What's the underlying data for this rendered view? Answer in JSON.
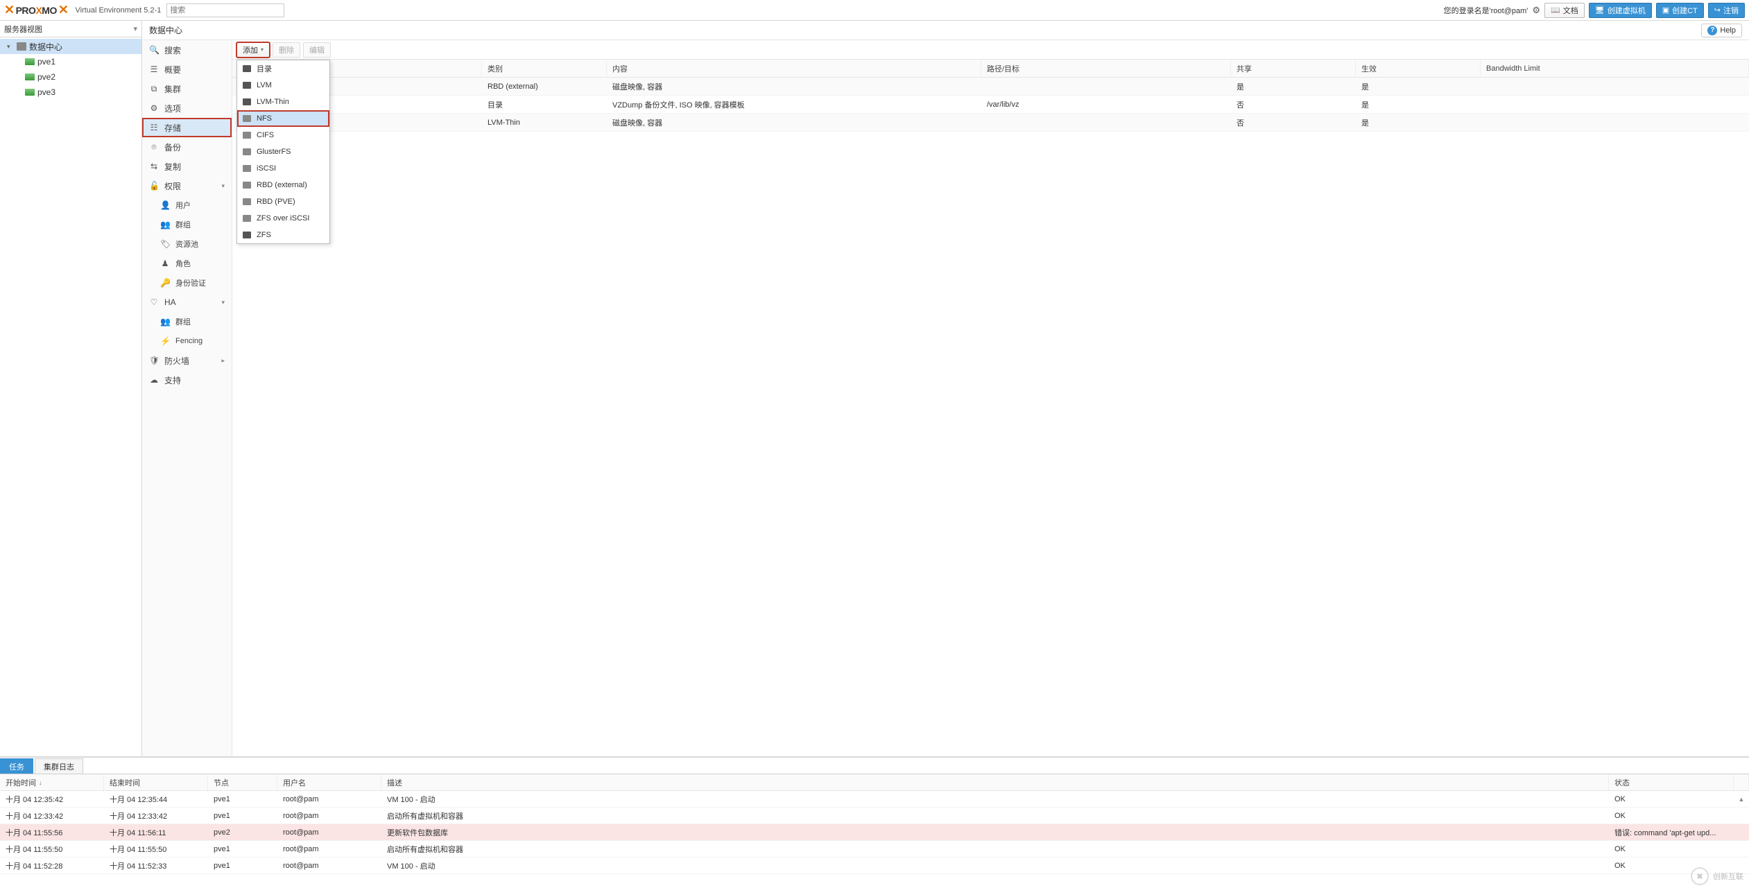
{
  "header": {
    "product": {
      "pro": "PRO",
      "x": "X",
      "mo": "MO"
    },
    "version_label": "Virtual Environment 5.2-1",
    "search_placeholder": "搜索",
    "login_text": "您的登录名是'root@pam'",
    "docs_label": "文档",
    "create_vm_label": "创建虚拟机",
    "create_ct_label": "创建CT",
    "logout_label": "注销"
  },
  "tree": {
    "view_label": "服务器视图",
    "datacenter_label": "数据中心",
    "nodes": [
      "pve1",
      "pve2",
      "pve3"
    ]
  },
  "crumb": {
    "title": "数据中心",
    "help": "Help"
  },
  "subnav": {
    "search": "搜索",
    "summary": "概要",
    "cluster": "集群",
    "options": "选项",
    "storage": "存储",
    "backup": "备份",
    "replication": "复制",
    "permissions": "权限",
    "users": "用户",
    "groups": "群组",
    "pools": "资源池",
    "roles": "角色",
    "auth": "身份验证",
    "ha": "HA",
    "ha_groups": "群组",
    "fencing": "Fencing",
    "firewall": "防火墙",
    "support": "支持"
  },
  "toolbar": {
    "add": "添加",
    "remove": "删除",
    "edit": "编辑"
  },
  "dropdown": {
    "items": [
      "目录",
      "LVM",
      "LVM-Thin",
      "NFS",
      "CIFS",
      "GlusterFS",
      "iSCSI",
      "RBD (external)",
      "RBD (PVE)",
      "ZFS over iSCSI",
      "ZFS"
    ]
  },
  "grid": {
    "cols": {
      "id": "",
      "type": "类别",
      "content": "内容",
      "path": "路径/目标",
      "shared": "共享",
      "enabled": "生效",
      "bw": "Bandwidth Limit"
    },
    "rows": [
      {
        "id": "",
        "type": "RBD (external)",
        "content": "磁盘映像, 容器",
        "path": "",
        "shared": "是",
        "enabled": "是",
        "bw": ""
      },
      {
        "id": "",
        "type": "目录",
        "content": "VZDump 备份文件, ISO 映像, 容器模板",
        "path": "/var/lib/vz",
        "shared": "否",
        "enabled": "是",
        "bw": ""
      },
      {
        "id": "",
        "type": "LVM-Thin",
        "content": "磁盘映像, 容器",
        "path": "",
        "shared": "否",
        "enabled": "是",
        "bw": ""
      }
    ]
  },
  "log": {
    "tabs": {
      "tasks": "任务",
      "cluster_log": "集群日志"
    },
    "cols": {
      "start": "开始时间",
      "end": "结束时间",
      "node": "节点",
      "user": "用户名",
      "desc": "描述",
      "status": "状态"
    },
    "rows": [
      {
        "start": "十月 04 12:35:42",
        "end": "十月 04 12:35:44",
        "node": "pve1",
        "user": "root@pam",
        "desc": "VM 100 - 启动",
        "status": "OK",
        "err": false
      },
      {
        "start": "十月 04 12:33:42",
        "end": "十月 04 12:33:42",
        "node": "pve1",
        "user": "root@pam",
        "desc": "启动所有虚拟机和容器",
        "status": "OK",
        "err": false
      },
      {
        "start": "十月 04 11:55:56",
        "end": "十月 04 11:56:11",
        "node": "pve2",
        "user": "root@pam",
        "desc": "更新软件包数据库",
        "status": "错误: command 'apt-get upd...",
        "err": true
      },
      {
        "start": "十月 04 11:55:50",
        "end": "十月 04 11:55:50",
        "node": "pve1",
        "user": "root@pam",
        "desc": "启动所有虚拟机和容器",
        "status": "OK",
        "err": false
      },
      {
        "start": "十月 04 11:52:28",
        "end": "十月 04 11:52:33",
        "node": "pve1",
        "user": "root@pam",
        "desc": "VM 100 - 启动",
        "status": "OK",
        "err": false
      }
    ]
  },
  "watermark": "创新互联"
}
